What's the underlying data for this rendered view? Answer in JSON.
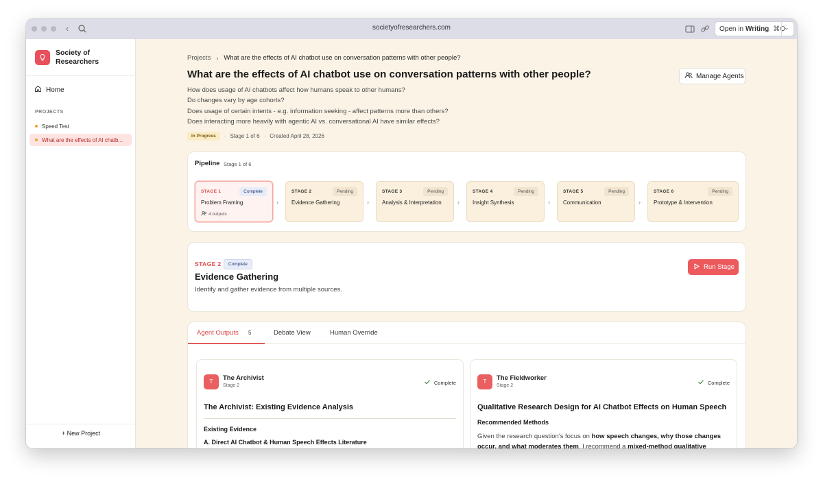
{
  "browser": {
    "url": "societyofresearchers.com",
    "open_in_prefix": "Open in",
    "open_in_app": "Writing",
    "open_in_shortcut": "⌘O"
  },
  "sidebar": {
    "brand": "Society of Researchers",
    "home_label": "Home",
    "section_label": "PROJECTS",
    "projects": [
      {
        "label": "Speed Test"
      },
      {
        "label": "What are the effects of AI chatb..."
      }
    ],
    "new_project_label": "New Project"
  },
  "header": {
    "breadcrumb_root": "Projects",
    "breadcrumb_current": "What are the effects of AI chatbot use on conversation patterns with other people?",
    "title": "What are the effects of AI chatbot use on conversation patterns with other people?",
    "manage_agents_label": "Manage Agents",
    "questions": [
      "How does usage of AI chatbots affect how humans speak to other humans?",
      "Do changes vary by age cohorts?",
      "Does usage of certain intents - e.g. information seeking - affect patterns more than others?",
      "Does interacting more heavily with agentic AI vs. conversational AI have similar effects?"
    ],
    "status_badge": "In Progress",
    "stage_meta": "Stage 1 of 6",
    "created_meta": "Created April 28, 2026"
  },
  "pipeline": {
    "title": "Pipeline",
    "subtitle": "Stage 1 of 6",
    "stages": [
      {
        "label": "STAGE 1",
        "status": "Complete",
        "name": "Problem Framing",
        "outputs": "4 outputs"
      },
      {
        "label": "STAGE 2",
        "status": "Pending",
        "name": "Evidence Gathering"
      },
      {
        "label": "STAGE 3",
        "status": "Pending",
        "name": "Analysis & Interpretation"
      },
      {
        "label": "STAGE 4",
        "status": "Pending",
        "name": "Insight Synthesis"
      },
      {
        "label": "STAGE 5",
        "status": "Pending",
        "name": "Communication"
      },
      {
        "label": "STAGE 6",
        "status": "Pending",
        "name": "Prototype & Intervention"
      }
    ]
  },
  "stage_detail": {
    "label": "STAGE 2",
    "status": "Complete",
    "title": "Evidence Gathering",
    "description": "Identify and gather evidence from multiple sources.",
    "run_label": "Run Stage"
  },
  "tabs": {
    "agent_outputs": "Agent Outputs",
    "agent_outputs_count": "5",
    "debate_view": "Debate View",
    "human_override": "Human Override"
  },
  "agents": [
    {
      "avatar": "T",
      "name": "The Archivist",
      "stage": "Stage 2",
      "status": "Complete",
      "title": "The Archivist: Existing Evidence Analysis",
      "section": "Existing Evidence",
      "subsection": "A. Direct AI Chatbot & Human Speech Effects Literature"
    },
    {
      "avatar": "T",
      "name": "The Fieldworker",
      "stage": "Stage 2",
      "status": "Complete",
      "title": "Qualitative Research Design for AI Chatbot Effects on Human Speech",
      "section": "Recommended Methods",
      "body_1": "Given the research question's focus on ",
      "body_b1": "how speech changes, why those changes occur, and what moderates them",
      "body_2": ", I recommend a ",
      "body_b2": "mixed-method qualitative"
    }
  ],
  "colors": {
    "accent": "#e8505b",
    "background": "#faf3e6",
    "pending_card": "#faf0dd"
  }
}
